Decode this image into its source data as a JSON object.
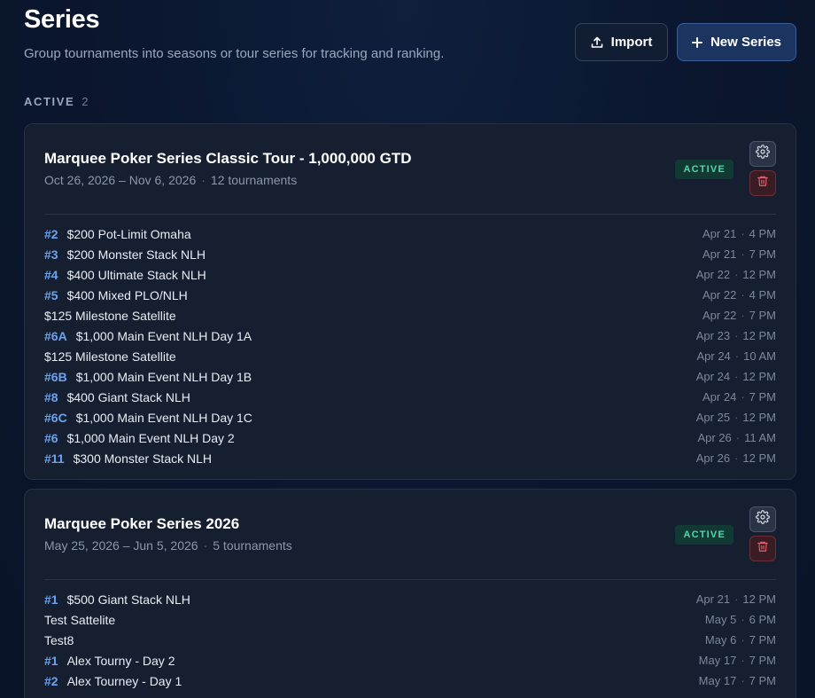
{
  "header": {
    "title": "Series",
    "subtitle": "Group tournaments into seasons or tour series for tracking and ranking.",
    "import_label": "Import",
    "new_series_label": "New Series"
  },
  "section": {
    "label": "ACTIVE",
    "count": "2"
  },
  "series": [
    {
      "title": "Marquee Poker Series Classic Tour - 1,000,000 GTD",
      "dates": "Oct 26, 2026 – Nov 6, 2026",
      "count": "12 tournaments",
      "status": "ACTIVE",
      "tournaments": [
        {
          "num": "#2",
          "name": "$200 Pot-Limit Omaha",
          "date": "Apr 21",
          "time": "4 PM"
        },
        {
          "num": "#3",
          "name": "$200 Monster Stack NLH",
          "date": "Apr 21",
          "time": "7 PM"
        },
        {
          "num": "#4",
          "name": "$400 Ultimate Stack NLH",
          "date": "Apr 22",
          "time": "12 PM"
        },
        {
          "num": "#5",
          "name": "$400 Mixed PLO/NLH",
          "date": "Apr 22",
          "time": "4 PM"
        },
        {
          "num": "",
          "name": "$125 Milestone Satellite",
          "date": "Apr 22",
          "time": "7 PM"
        },
        {
          "num": "#6A",
          "name": "$1,000 Main Event NLH Day 1A",
          "date": "Apr 23",
          "time": "12 PM"
        },
        {
          "num": "",
          "name": "$125 Milestone Satellite",
          "date": "Apr 24",
          "time": "10 AM"
        },
        {
          "num": "#6B",
          "name": "$1,000 Main Event NLH Day 1B",
          "date": "Apr 24",
          "time": "12 PM"
        },
        {
          "num": "#8",
          "name": "$400 Giant Stack NLH",
          "date": "Apr 24",
          "time": "7 PM"
        },
        {
          "num": "#6C",
          "name": "$1,000 Main Event NLH Day 1C",
          "date": "Apr 25",
          "time": "12 PM"
        },
        {
          "num": "#6",
          "name": "$1,000 Main Event NLH Day 2",
          "date": "Apr 26",
          "time": "11 AM"
        },
        {
          "num": "#11",
          "name": "$300 Monster Stack NLH",
          "date": "Apr 26",
          "time": "12 PM"
        }
      ]
    },
    {
      "title": "Marquee Poker Series 2026",
      "dates": "May 25, 2026 – Jun 5, 2026",
      "count": "5 tournaments",
      "status": "ACTIVE",
      "tournaments": [
        {
          "num": "#1",
          "name": "$500 Giant Stack NLH",
          "date": "Apr 21",
          "time": "12 PM"
        },
        {
          "num": "",
          "name": "Test Sattelite",
          "date": "May 5",
          "time": "6 PM"
        },
        {
          "num": "",
          "name": "Test8",
          "date": "May 6",
          "time": "7 PM"
        },
        {
          "num": "#1",
          "name": "Alex Tourny - Day 2",
          "date": "May 17",
          "time": "7 PM"
        },
        {
          "num": "#2",
          "name": "Alex Tourney - Day 1",
          "date": "May 17",
          "time": "7 PM"
        }
      ]
    }
  ],
  "icons": {
    "import": "upload-icon",
    "new": "plus-icon",
    "settings": "gear-icon",
    "delete": "trash-icon"
  },
  "colors": {
    "background": "#0b1730",
    "card": "#161f30",
    "accent_number": "#6aa4f0",
    "active_badge_text": "#4fd8a8",
    "active_badge_bg": "#123a35",
    "danger": "#e06070"
  }
}
